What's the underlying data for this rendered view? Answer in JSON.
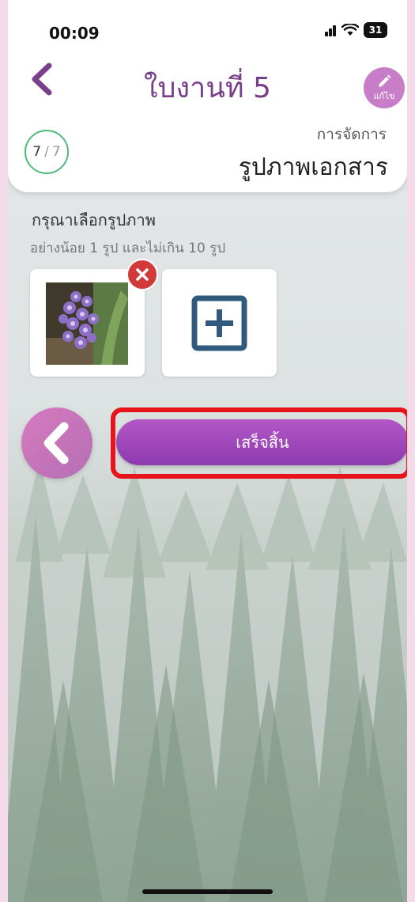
{
  "status_bar": {
    "time": "00:09",
    "battery": "31"
  },
  "header": {
    "title": "ใบงานที่ 5",
    "edit_label": "แก้ไข",
    "progress_current": "7",
    "progress_total": "7",
    "manage_label": "การจัดการ",
    "section_title": "รูปภาพเอกสาร"
  },
  "main": {
    "choose_label": "กรุณาเลือกรูปภาพ",
    "hint": "อย่างน้อย 1 รูป และไม่เกิน 10 รูป",
    "finish_button": "เสร็จสิ้น"
  },
  "colors": {
    "accent": "#7a3f8a",
    "button": "#9b45b8",
    "progress_ring": "#4fb87a",
    "remove": "#d23a3a",
    "highlight": "#e8141c"
  }
}
